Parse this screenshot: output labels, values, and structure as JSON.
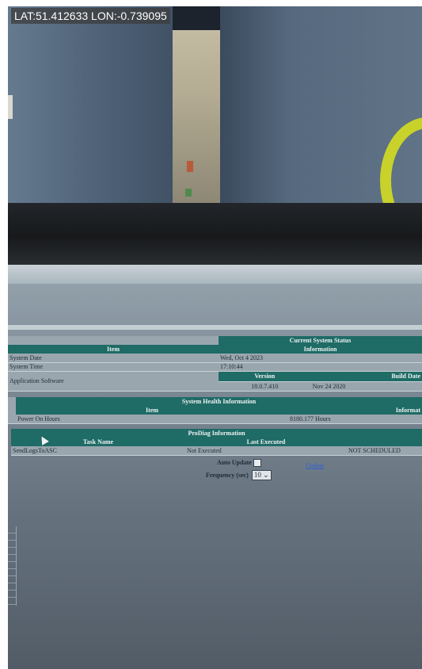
{
  "overlay": {
    "gps": "LAT:51.412633 LON:-0.739095"
  },
  "status": {
    "title": "Current System Status",
    "col_item": "Item",
    "col_info": "Information",
    "rows": [
      {
        "item": "System Date",
        "info": "Wed, Oct 4 2023"
      },
      {
        "item": "System Time",
        "info": "17:10:44"
      }
    ],
    "app_label": "Application Software",
    "version_header": "Version",
    "build_header": "Build Date",
    "version": "18.0.7.410",
    "build_date": "Nov 24 2020"
  },
  "health": {
    "title": "System Health Information",
    "col_item": "Item",
    "col_info": "Informat",
    "rows": [
      {
        "item": "Power On Hours",
        "info": "8180.177 Hours"
      }
    ]
  },
  "prodiag": {
    "title": "ProDiag Information",
    "col_task": "Task Name",
    "col_last": "Last Executed",
    "rows": [
      {
        "task": "SendLogsToASC",
        "last": "Not Executed",
        "next": "NOT SCHEDULED"
      }
    ]
  },
  "controls": {
    "auto_update_label": "Auto Update",
    "frequency_label": "Frequency (sec)",
    "frequency_value": "10",
    "update_link": "Update"
  }
}
